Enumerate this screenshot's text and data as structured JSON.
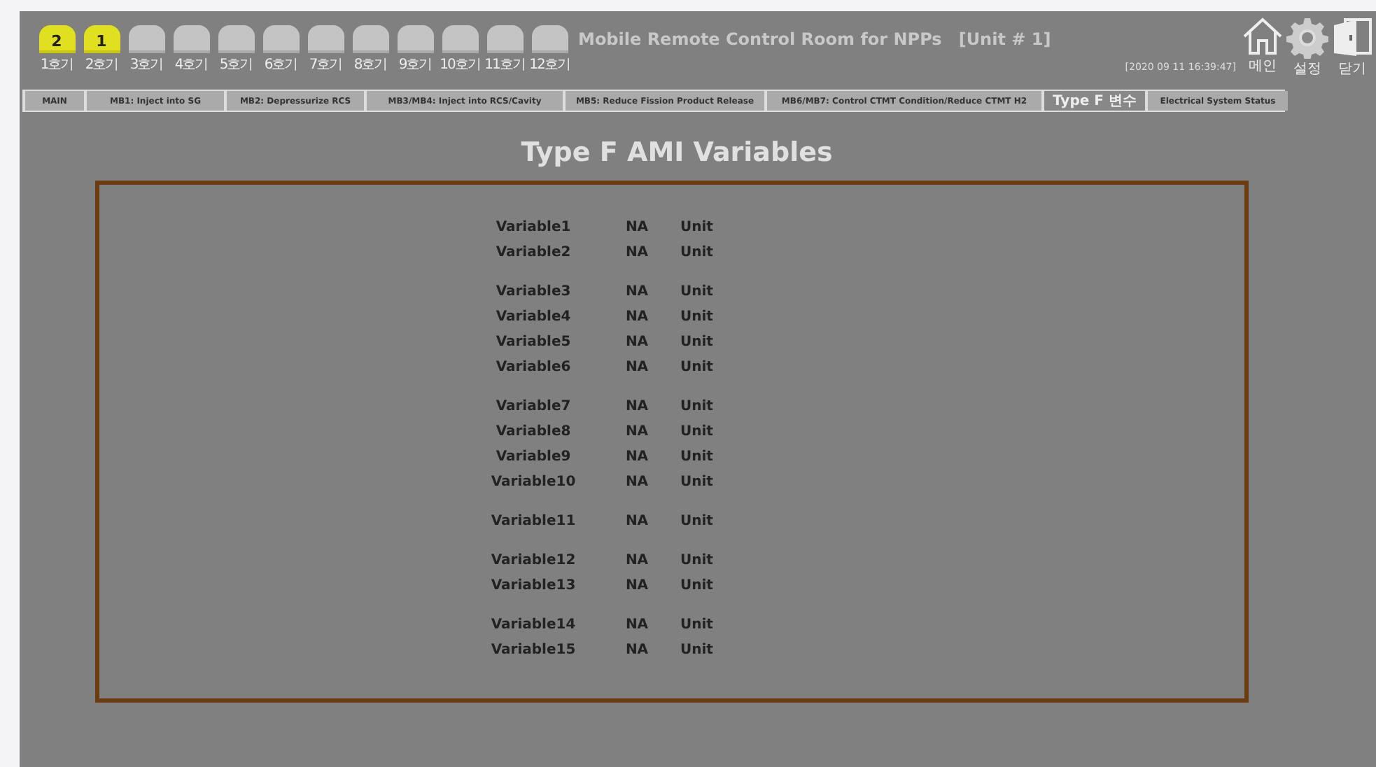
{
  "units": [
    {
      "badge": "2",
      "label": "1호기",
      "active": true
    },
    {
      "badge": "1",
      "label": "2호기",
      "active": true
    },
    {
      "label": "3호기",
      "active": false
    },
    {
      "label": "4호기",
      "active": false
    },
    {
      "label": "5호기",
      "active": false
    },
    {
      "label": "6호기",
      "active": false
    },
    {
      "label": "7호기",
      "active": false
    },
    {
      "label": "8호기",
      "active": false
    },
    {
      "label": "9호기",
      "active": false
    },
    {
      "label": "10호기",
      "active": false
    },
    {
      "label": "11호기",
      "active": false
    },
    {
      "label": "12호기",
      "active": false
    }
  ],
  "window": {
    "title": "Mobile Remote Control Room for NPPs",
    "unit": "[Unit # 1]",
    "timestamp": "[2020 09 11 16:39:47]"
  },
  "toolbar": [
    {
      "kind": "home",
      "label": "메인"
    },
    {
      "kind": "settings",
      "label": "설정"
    },
    {
      "kind": "exit",
      "label": "닫기"
    }
  ],
  "tabs": [
    {
      "label": "MAIN",
      "selected": false
    },
    {
      "label": "MB1: Inject into SG",
      "selected": false
    },
    {
      "label": "MB2: Depressurize RCS",
      "selected": false
    },
    {
      "label": "MB3/MB4: Inject into RCS/Cavity",
      "selected": false
    },
    {
      "label": "MB5: Reduce Fission Product Release",
      "selected": false
    },
    {
      "label": "MB6/MB7: Control CTMT Condition/Reduce CTMT H2",
      "selected": false
    },
    {
      "label": "Type F 변수",
      "selected": true
    },
    {
      "label": "Electrical System Status",
      "selected": false
    }
  ],
  "heading": "Type F AMI Variables",
  "groups": [
    {
      "rows": [
        {
          "name": "Variable1",
          "value": "NA",
          "unit": "Unit"
        },
        {
          "name": "Variable2",
          "value": "NA",
          "unit": "Unit"
        }
      ]
    },
    {
      "rows": [
        {
          "name": "Variable3",
          "value": "NA",
          "unit": "Unit"
        },
        {
          "name": "Variable4",
          "value": "NA",
          "unit": "Unit"
        },
        {
          "name": "Variable5",
          "value": "NA",
          "unit": "Unit"
        },
        {
          "name": "Variable6",
          "value": "NA",
          "unit": "Unit"
        }
      ]
    },
    {
      "rows": [
        {
          "name": "Variable7",
          "value": "NA",
          "unit": "Unit"
        },
        {
          "name": "Variable8",
          "value": "NA",
          "unit": "Unit"
        },
        {
          "name": "Variable9",
          "value": "NA",
          "unit": "Unit"
        },
        {
          "name": "Variable10",
          "value": "NA",
          "unit": "Unit"
        }
      ]
    },
    {
      "rows": [
        {
          "name": "Variable11",
          "value": "NA",
          "unit": "Unit"
        }
      ]
    },
    {
      "rows": [
        {
          "name": "Variable12",
          "value": "NA",
          "unit": "Unit"
        },
        {
          "name": "Variable13",
          "value": "NA",
          "unit": "Unit"
        }
      ]
    },
    {
      "rows": [
        {
          "name": "Variable14",
          "value": "NA",
          "unit": "Unit"
        },
        {
          "name": "Variable15",
          "value": "NA",
          "unit": "Unit"
        }
      ]
    }
  ]
}
